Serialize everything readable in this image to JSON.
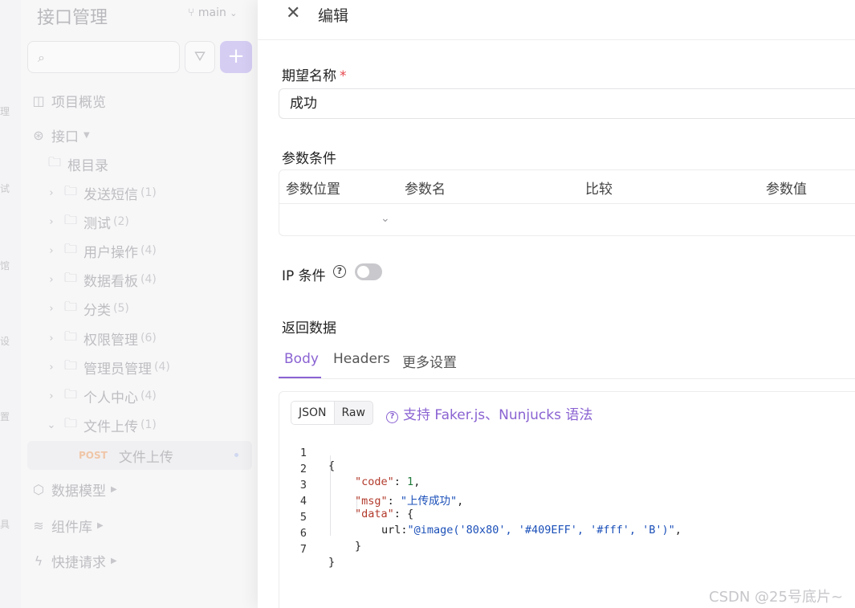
{
  "rail": {
    "chars": [
      "理",
      "试",
      "馆",
      "设",
      "置",
      "具"
    ]
  },
  "sidebar": {
    "title": "接口管理",
    "branch": "main",
    "tree": [
      {
        "label": "项目概览"
      },
      {
        "label": "接口"
      },
      {
        "label": "根目录"
      },
      {
        "label": "发送短信",
        "count": "(1)"
      },
      {
        "label": "测试",
        "count": "(2)"
      },
      {
        "label": "用户操作",
        "count": "(4)"
      },
      {
        "label": "数据看板",
        "count": "(4)"
      },
      {
        "label": "分类",
        "count": "(5)"
      },
      {
        "label": "权限管理",
        "count": "(6)"
      },
      {
        "label": "管理员管理",
        "count": "(4)"
      },
      {
        "label": "个人中心",
        "count": "(4)"
      },
      {
        "label": "文件上传",
        "count": "(1)"
      },
      {
        "method": "POST",
        "label": "文件上传"
      },
      {
        "label": "数据模型"
      },
      {
        "label": "组件库"
      },
      {
        "label": "快捷请求"
      }
    ]
  },
  "drawer": {
    "title": "编辑",
    "name_label": "期望名称",
    "required_mark": "*",
    "name_value": "成功",
    "params_label": "参数条件",
    "params_columns": [
      "参数位置",
      "参数名",
      "比较",
      "参数值"
    ],
    "ip_label": "IP 条件",
    "ip_enabled": false,
    "return_label": "返回数据",
    "tabs": [
      "Body",
      "Headers",
      "更多设置"
    ],
    "active_tab": "Body",
    "formats": [
      "JSON",
      "Raw"
    ],
    "hint": "支持 Faker.js、Nunjucks 语法",
    "code": {
      "line_numbers": [
        "1",
        "2",
        "3",
        "4",
        "5",
        "6",
        "7"
      ],
      "open_brace": "{",
      "close_brace": "}",
      "code_key": "\"code\"",
      "code_value": "1",
      "msg_key": "\"msg\"",
      "msg_value": "\"上传成功\"",
      "data_key": "\"data\"",
      "data_open": "{",
      "url_key": "url",
      "url_value": "\"@image('80x80', '#409EFF', '#fff', 'B')\"",
      "data_close": "}"
    }
  },
  "watermark": "CSDN @25号底片~",
  "colors": {
    "accent": "#8a63d2",
    "required": "#e5484d",
    "post": "#f0c6a8"
  }
}
